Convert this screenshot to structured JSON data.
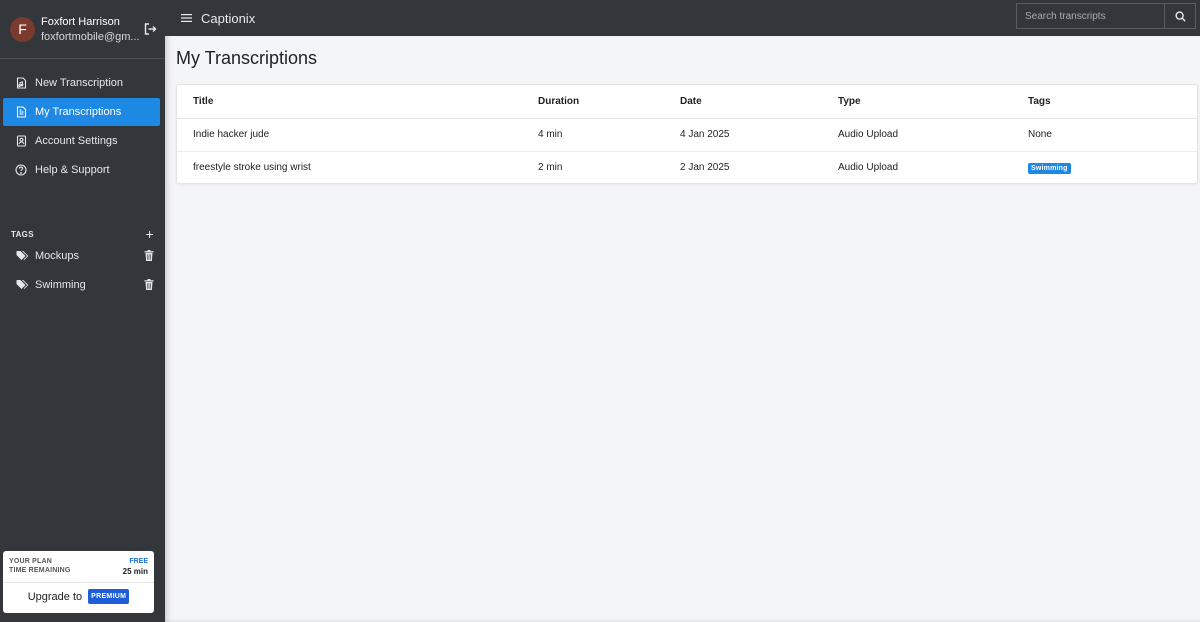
{
  "user": {
    "initial": "F",
    "name": "Foxfort Harrison",
    "email": "foxfortmobile@gm..."
  },
  "nav": [
    {
      "label": "New Transcription",
      "icon": "audio-file-icon",
      "active": false
    },
    {
      "label": "My Transcriptions",
      "icon": "document-icon",
      "active": true
    },
    {
      "label": "Account Settings",
      "icon": "account-settings-icon",
      "active": false
    },
    {
      "label": "Help & Support",
      "icon": "help-circle-icon",
      "active": false
    }
  ],
  "tags_section": {
    "heading": "TAGS",
    "add_label": "+"
  },
  "tags": [
    {
      "label": "Mockups"
    },
    {
      "label": "Swimming"
    }
  ],
  "plan": {
    "plan_label": "YOUR PLAN",
    "plan_value": "FREE",
    "time_label": "TIME REMAINING",
    "time_value": "25 min",
    "upgrade_label": "Upgrade to",
    "premium_label": "PREMIUM"
  },
  "topbar": {
    "app_name": "Captionix",
    "search_placeholder": "Search transcripts"
  },
  "main": {
    "title": "My Transcriptions",
    "columns": [
      "Title",
      "Duration",
      "Date",
      "Type",
      "Tags"
    ],
    "rows": [
      {
        "title": "Indie hacker jude",
        "duration": "4 min",
        "date": "4 Jan 2025",
        "type": "Audio Upload",
        "tags": "None",
        "tag_is_badge": false
      },
      {
        "title": "freestyle stroke using wrist",
        "duration": "2 min",
        "date": "2 Jan 2025",
        "type": "Audio Upload",
        "tags": "Swimming",
        "tag_is_badge": true
      }
    ]
  },
  "colors": {
    "sidebar_bg": "#33363b",
    "accent": "#1e88e5",
    "premium": "#1e5fd9",
    "avatar": "#7a3b2e"
  }
}
